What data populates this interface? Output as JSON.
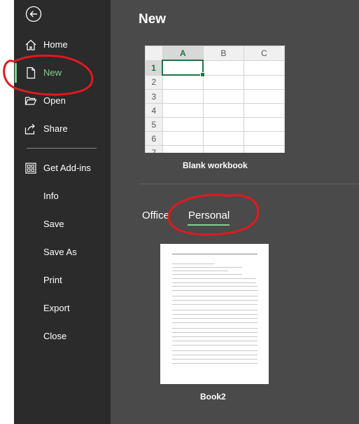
{
  "sidebar": {
    "back_icon": "back-arrow-icon",
    "items": [
      {
        "label": "Home",
        "icon": "home-icon"
      },
      {
        "label": "New",
        "icon": "new-document-icon",
        "active": true
      },
      {
        "label": "Open",
        "icon": "open-folder-icon"
      },
      {
        "label": "Share",
        "icon": "share-icon"
      },
      {
        "label": "Get Add-ins",
        "icon": "add-ins-icon"
      },
      {
        "label": "Info"
      },
      {
        "label": "Save"
      },
      {
        "label": "Save As"
      },
      {
        "label": "Print"
      },
      {
        "label": "Export"
      },
      {
        "label": "Close"
      }
    ]
  },
  "main": {
    "title": "New",
    "blank_workbook": {
      "label": "Blank workbook",
      "columns": [
        "A",
        "B",
        "C"
      ],
      "rows": [
        "1",
        "2",
        "3",
        "4",
        "5",
        "6",
        "7"
      ]
    },
    "tabs": [
      {
        "label": "Office"
      },
      {
        "label": "Personal",
        "active": true
      }
    ],
    "templates": [
      {
        "label": "Book2"
      }
    ]
  },
  "colors": {
    "sidebar_bg": "#2b2b2b",
    "main_bg": "#4a4a4a",
    "accent": "#7fd18b",
    "excel_green": "#217346",
    "annotation": "#e0191f"
  }
}
